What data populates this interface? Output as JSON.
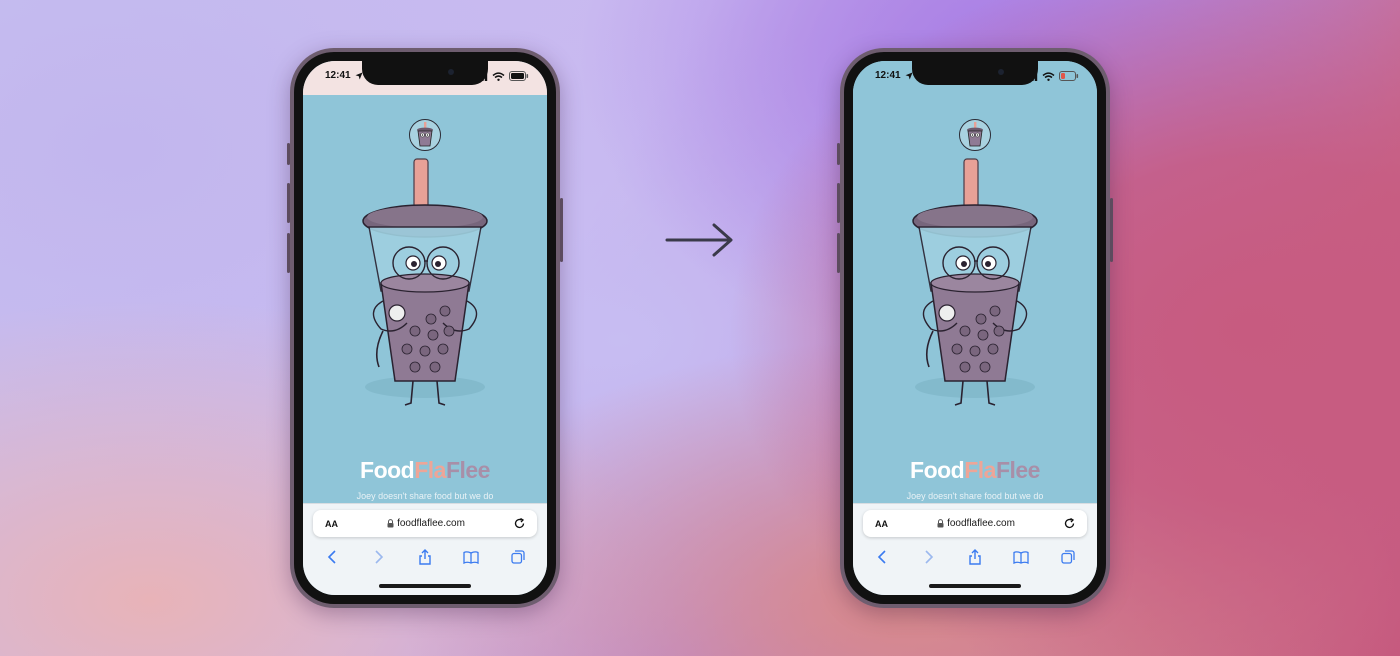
{
  "colors": {
    "screen_bg": "#8fc5d8",
    "brand_food": "#ffffff",
    "brand_fla": "#eea597",
    "brand_flee": "#a88fa8",
    "cup_liquid": "#8f7a94",
    "straw": "#e8a197"
  },
  "phones": [
    {
      "status_time": "12:41",
      "brand": {
        "part1": "Food",
        "part2": "Fla",
        "part3": "Flee"
      },
      "tagline": "Joey doesn't share food but we do",
      "browser": {
        "text_size_label": "AA",
        "url": "foodflaflee.com"
      }
    },
    {
      "status_time": "12:41",
      "brand": {
        "part1": "Food",
        "part2": "Fla",
        "part3": "Flee"
      },
      "tagline": "Joey doesn't share food but we do",
      "browser": {
        "text_size_label": "AA",
        "url": "foodflaflee.com"
      }
    }
  ],
  "icons": {
    "location": "location-arrow-icon",
    "signal": "signal-icon",
    "wifi": "wifi-icon",
    "battery": "battery-icon",
    "lock": "lock-icon",
    "reload": "reload-icon",
    "back": "back-icon",
    "forward": "forward-icon",
    "share": "share-icon",
    "bookmarks": "bookmarks-icon",
    "tabs": "tabs-icon",
    "transition_arrow": "right-arrow-icon"
  }
}
